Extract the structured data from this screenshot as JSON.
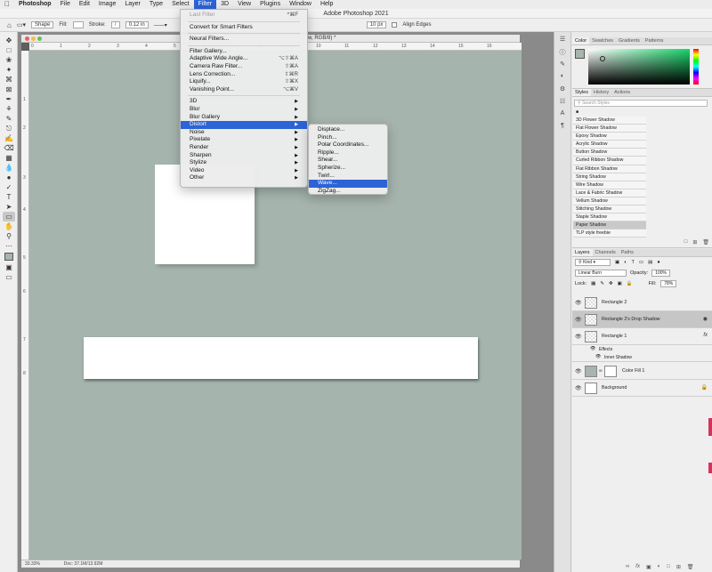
{
  "menubar": {
    "app": "Photoshop",
    "items": [
      "File",
      "Edit",
      "Image",
      "Layer",
      "Type",
      "Select",
      "Filter",
      "3D",
      "View",
      "Plugins",
      "Window",
      "Help"
    ],
    "active": "Filter"
  },
  "window": {
    "title": "Adobe Photoshop 2021"
  },
  "options": {
    "shape_mode": "Shape",
    "fill_label": "Fill:",
    "stroke_label": "Stroke:",
    "stroke_width": "0.12 in",
    "radius": "10 px",
    "align_edges": "Align Edges"
  },
  "document": {
    "title_fragment": "w, RGB/8) *",
    "zoom": "33.33%",
    "doc_size": "Doc: 37.1M/13.92M",
    "ruler_h": [
      "0",
      "1",
      "2",
      "3",
      "4",
      "5",
      "6",
      "7",
      "8",
      "9",
      "10",
      "11",
      "12",
      "13",
      "14",
      "15",
      "16"
    ],
    "ruler_v": [
      "1",
      "2",
      "3",
      "4",
      "5",
      "6",
      "7",
      "8"
    ]
  },
  "filter_menu": {
    "groups": [
      [
        {
          "label": "Last Filter",
          "shortcut": "^⌘F",
          "disabled": true
        }
      ],
      [
        {
          "label": "Convert for Smart Filters"
        }
      ],
      [
        {
          "label": "Neural Filters..."
        }
      ],
      [
        {
          "label": "Filter Gallery..."
        },
        {
          "label": "Adaptive Wide Angle...",
          "shortcut": "⌥⇧⌘A"
        },
        {
          "label": "Camera Raw Filter...",
          "shortcut": "⇧⌘A"
        },
        {
          "label": "Lens Correction...",
          "shortcut": "⇧⌘R"
        },
        {
          "label": "Liquify...",
          "shortcut": "⇧⌘X"
        },
        {
          "label": "Vanishing Point...",
          "shortcut": "⌥⌘V"
        }
      ],
      [
        {
          "label": "3D",
          "submenu": true
        },
        {
          "label": "Blur",
          "submenu": true
        },
        {
          "label": "Blur Gallery",
          "submenu": true
        },
        {
          "label": "Distort",
          "submenu": true,
          "highlight": true
        },
        {
          "label": "Noise",
          "submenu": true
        },
        {
          "label": "Pixelate",
          "submenu": true
        },
        {
          "label": "Render",
          "submenu": true
        },
        {
          "label": "Sharpen",
          "submenu": true
        },
        {
          "label": "Stylize",
          "submenu": true
        },
        {
          "label": "Video",
          "submenu": true
        },
        {
          "label": "Other",
          "submenu": true
        }
      ]
    ]
  },
  "distort_menu": {
    "items": [
      "Displace...",
      "Pinch...",
      "Polar Coordinates...",
      "Ripple...",
      "Shear...",
      "Spherize...",
      "Twirl...",
      "Wave...",
      "ZigZag..."
    ],
    "highlight": "Wave..."
  },
  "color_panel": {
    "tabs": [
      "Color",
      "Swatches",
      "Gradients",
      "Patterns"
    ],
    "foreground": "#a7b5ac"
  },
  "styles_panel": {
    "tabs": [
      "Styles",
      "History",
      "Actions"
    ],
    "search_placeholder": "Search Styles",
    "items": [
      "3D Flower Shadow",
      "Flat Flower Shadow",
      "Epoxy Shadow",
      "Acrylic Shadow",
      "Button Shadow",
      "Curled Ribbon Shadow",
      "Flat Ribbon Shadow",
      "String Shadow",
      "Wire Shadow",
      "Lace & Fabric Shadow",
      "Vellum Shadow",
      "Stitching Shadow",
      "Staple Shadow",
      "Paper Shadow",
      "TLP style freebie"
    ],
    "selected": "Paper Shadow"
  },
  "layers_panel": {
    "tabs": [
      "Layers",
      "Channels",
      "Paths"
    ],
    "kind_label": "Kind",
    "blend_mode": "Linear Burn",
    "opacity_label": "Opacity:",
    "opacity": "100%",
    "lock_label": "Lock:",
    "fill_label": "Fill:",
    "fill": "78%",
    "layers": [
      {
        "name": "Rectangle 2",
        "type": "shape"
      },
      {
        "name": "Rectangle 2's Drop Shadow",
        "type": "shape",
        "selected": true
      },
      {
        "name": "Rectangle 1",
        "type": "shape",
        "fx": "fx"
      },
      {
        "name": "Color Fill 1",
        "type": "fill"
      },
      {
        "name": "Background",
        "type": "bg"
      }
    ],
    "effects_label": "Effects",
    "inner_shadow_label": "Inner Shadow"
  },
  "colors": {
    "canvas": "#a5b4ad",
    "menu_highlight": "#2c63d6"
  }
}
